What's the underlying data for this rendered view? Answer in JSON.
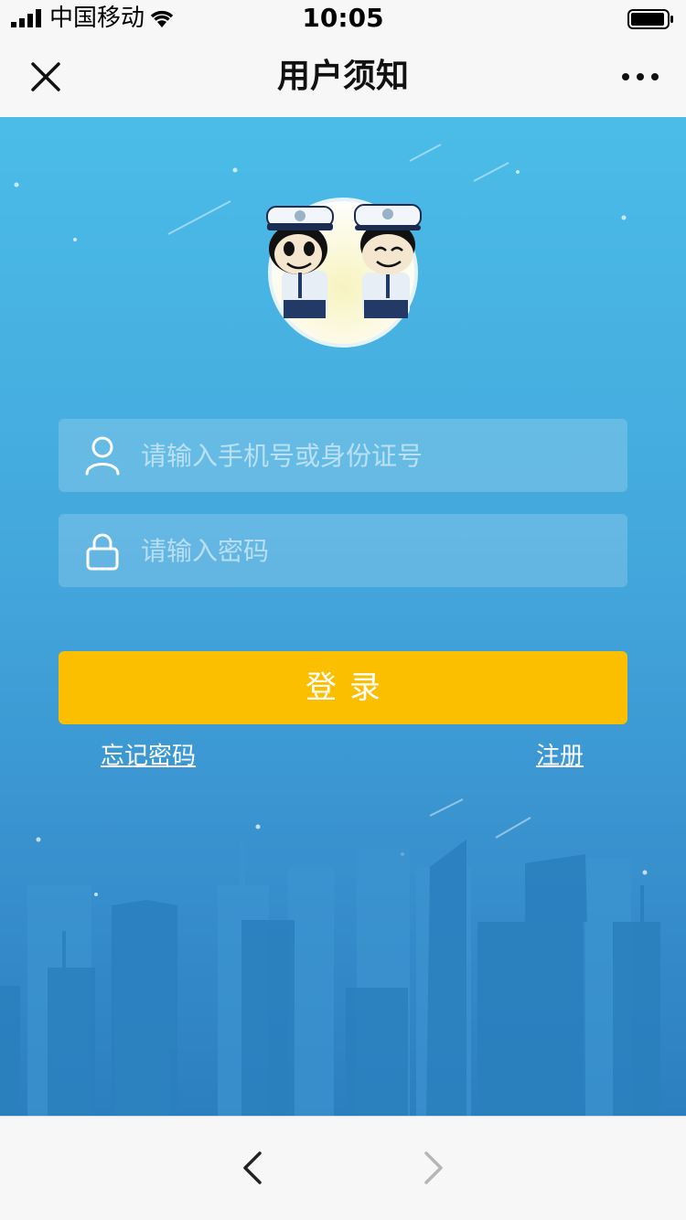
{
  "status_bar": {
    "carrier": "中国移动",
    "time": "10:05",
    "icons": [
      "signal-icon",
      "wifi-icon",
      "battery-icon"
    ]
  },
  "nav": {
    "title": "用户须知",
    "close_icon": "close-icon",
    "more_icon": "more-icon"
  },
  "login": {
    "account_placeholder": "请输入手机号或身份证号",
    "password_placeholder": "请输入密码",
    "account_icon": "user-icon",
    "password_icon": "lock-icon",
    "submit_label": "登录",
    "forgot_label": "忘记密码",
    "register_label": "注册"
  },
  "toolbar": {
    "back_icon": "chevron-left-icon",
    "forward_icon": "chevron-right-icon"
  },
  "colors": {
    "accent_button": "#fcbf00",
    "background_top": "#4bbce8",
    "background_bottom": "#2c7fbf"
  }
}
